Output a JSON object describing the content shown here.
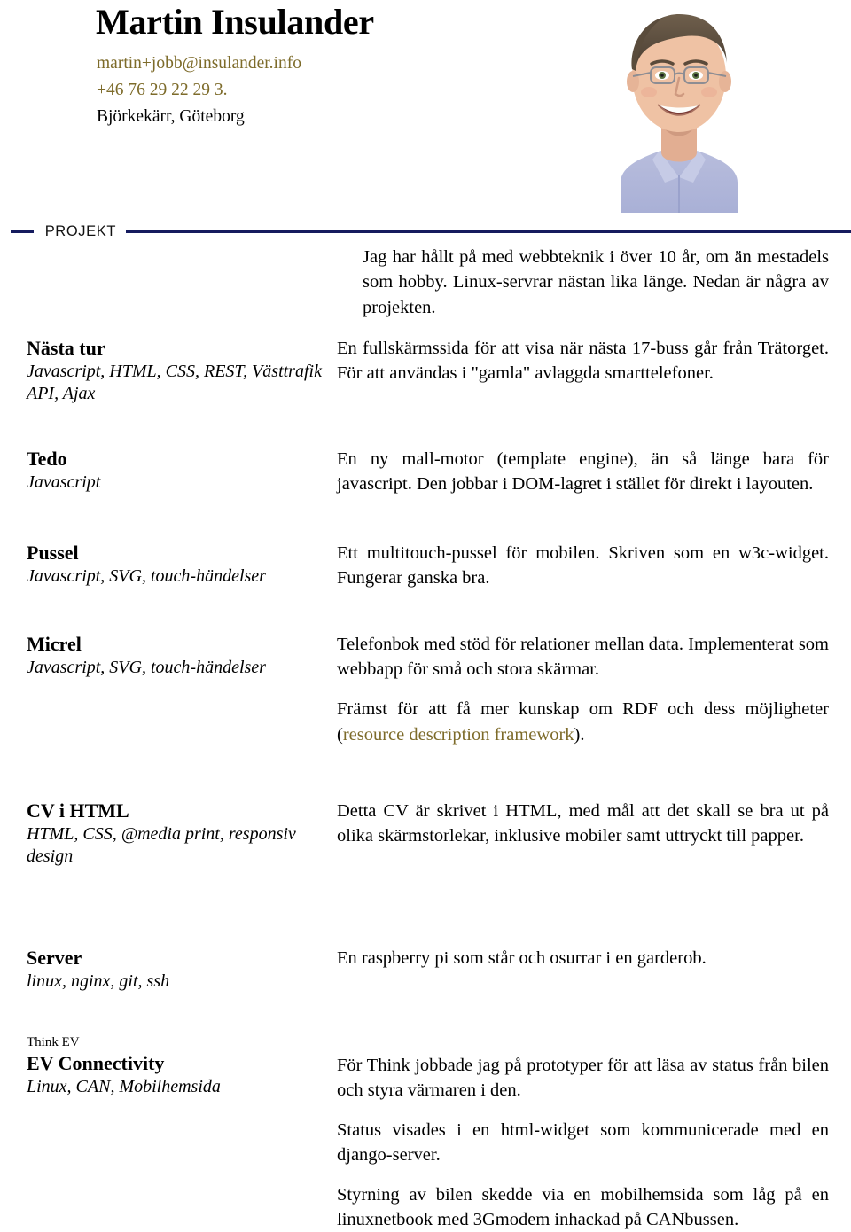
{
  "header": {
    "name": "Martin Insulander",
    "email": "martin+jobb@insulander.info",
    "phone": "+46 76 29 22 29 3.",
    "location": "Björkekärr, Göteborg",
    "photo_alt": "portrait-photo",
    "link_color": "#7d6b2a"
  },
  "section": {
    "label": "PROJEKT",
    "rule_color": "#151b5e"
  },
  "intro": "Jag har hållt på med webbteknik i över 10 år, om än mestadels som hobby. Linux-servrar nästan lika länge. Nedan är några av projekten.",
  "projects": [
    {
      "title": "Nästa tur",
      "eyebrow": "",
      "tech": "Javascript, HTML, CSS, REST, Västtrafik API, Ajax",
      "paragraphs": [
        "En fullskärmssida för att visa när nästa 17-buss går från Trätorget. För att användas i \"gamla\" avlaggda smarttelefoner."
      ]
    },
    {
      "title": "Tedo",
      "eyebrow": "",
      "tech": "Javascript",
      "paragraphs": [
        "En ny mall-motor (template engine), än så länge bara för javascript. Den jobbar i DOM-lagret i stället för direkt i layouten."
      ]
    },
    {
      "title": "Pussel",
      "eyebrow": "",
      "tech": "Javascript, SVG, touch-händelser",
      "paragraphs": [
        "Ett multitouch-pussel för mobilen. Skriven som en w3c-widget. Fungerar ganska bra."
      ]
    },
    {
      "title": "Micrel",
      "eyebrow": "",
      "tech": "Javascript, SVG, touch-händelser",
      "paragraphs": [
        "Telefonbok med stöd för relationer mellan data. Implementerat som webbapp för små och stora skärmar."
      ],
      "paragraph2_pre": "Främst för att få mer kunskap om RDF och dess möjligheter (",
      "paragraph2_link": "resource description framework",
      "paragraph2_post": ")."
    },
    {
      "title": "CV i HTML",
      "eyebrow": "",
      "tech": "HTML, CSS, @media print, responsiv design",
      "paragraphs": [
        "Detta CV är skrivet i HTML, med mål att det skall se bra ut på olika skärmstorlekar, inklusive mobiler samt uttryckt till papper."
      ]
    },
    {
      "title": "Server",
      "eyebrow": "",
      "tech": "linux, nginx, git, ssh",
      "paragraphs": [
        "En raspberry pi som står och osurrar i en garderob."
      ]
    },
    {
      "title": "EV Connectivity",
      "eyebrow": "Think EV",
      "tech": "Linux, CAN, Mobilhemsida",
      "paragraphs": [
        "För Think jobbade jag på prototyper för att läsa av status från bilen och styra värmaren i den.",
        "Status visades i en html-widget som kommunicerade med en django-server.",
        "Styrning av bilen skedde via en mobilhemsida som låg på en linuxnetbook med 3Gmodem inhackad på CANbussen."
      ]
    }
  ]
}
